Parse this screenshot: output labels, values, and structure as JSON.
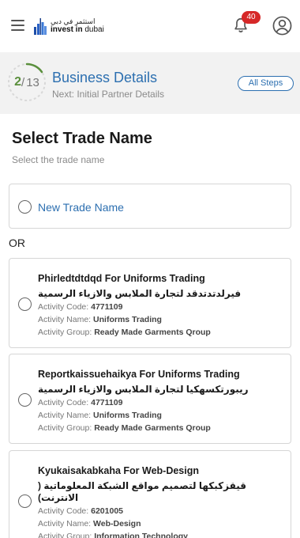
{
  "header": {
    "logo_ar": "استثمر في دبي",
    "logo_en_bold": "invest in",
    "logo_en_rest": " dubai",
    "notification_count": "40"
  },
  "progress": {
    "current": "2",
    "separator": "/",
    "total": "13",
    "fraction": 0.154,
    "title": "Business Details",
    "next_label": "Next: Initial Partner Details",
    "all_steps_label": "All Steps"
  },
  "page": {
    "title": "Select Trade Name",
    "subtitle": "Select the trade name",
    "new_trade_label": "New Trade Name",
    "or_label": "OR"
  },
  "labels": {
    "activity_code": "Activity Code:",
    "activity_name": "Activity Name:",
    "activity_group": "Activity Group:"
  },
  "trade_names": [
    {
      "name_en": "Phirledtdtdqd For Uniforms Trading",
      "name_ar": "فيرلدتدتدقد لتجارة الملابس والازياء الرسمية",
      "activity_code": "4771109",
      "activity_name": "Uniforms Trading",
      "activity_group": "Ready Made Garments Qroup"
    },
    {
      "name_en": "Reportkaissuehaikya For Uniforms Trading",
      "name_ar": "ريبورتكسهكيا لتجارة الملابس والازياء الرسمية",
      "activity_code": "4771109",
      "activity_name": "Uniforms Trading",
      "activity_group": "Ready Made Garments Qroup"
    },
    {
      "name_en": "Kyukaisakabkaha For Web-Design",
      "name_ar": "قيقزكبكها لتصميم مواقع الشبكة المعلوماتية ( الانترنت)",
      "activity_code": "6201005",
      "activity_name": "Web-Design",
      "activity_group": "Information Technology"
    }
  ],
  "colors": {
    "accent_blue": "#2c6fb0",
    "progress_green": "#5a8f3c",
    "badge_red": "#d62828"
  }
}
